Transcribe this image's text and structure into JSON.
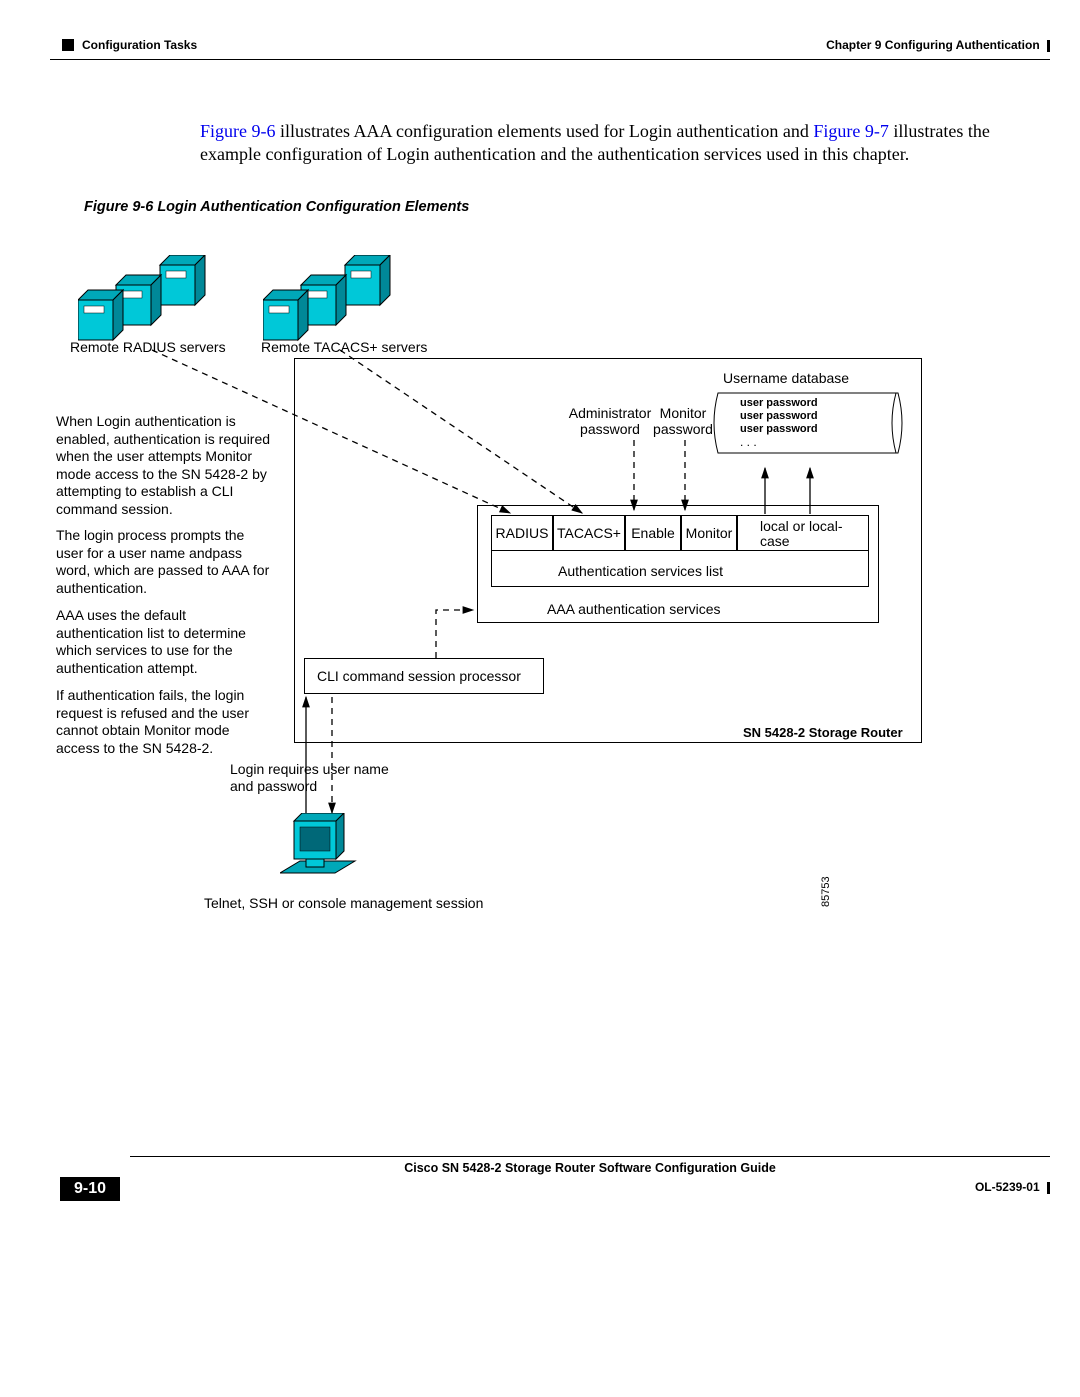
{
  "header": {
    "left": "Configuration Tasks",
    "right": "Chapter 9      Configuring Authentication"
  },
  "body": {
    "link1": "Figure 9-6",
    "text1": " illustrates AAA configuration elements used for Login authentication and ",
    "link2": "Figure 9-7",
    "text2": " illustrates the example configuration of Login authentication and the authentication services used in this chapter."
  },
  "figCaption": "Figure 9-6      Login Authentication Configuration Elements",
  "diagram": {
    "radiusServers": "Remote RADIUS servers",
    "tacacsServers": "Remote TACACS+ servers",
    "usernameDb": "Username database",
    "userPw1": "user    password",
    "userPw2": "user    password",
    "userPw3": "user    password",
    "dots": ". . .",
    "adminPw": "Administrator password",
    "monitorPw": "Monitor password",
    "radius": "RADIUS",
    "tacacs": "TACACS+",
    "enable": "Enable",
    "monitor": "Monitor",
    "localOr": "local or local-case",
    "authList": "Authentication services list",
    "aaaServices": "AAA authentication services",
    "cliProcessor": "CLI command session processor",
    "routerLabel": "SN 5428-2 Storage Router",
    "loginReq": "Login requires user name and password",
    "telnet": "Telnet, SSH or console management session",
    "idnum": "85753",
    "exp1": "When Login authentication is enabled, authentication is required when the user attempts Monitor mode access to the SN 5428-2 by attempting to establish a CLI command session.",
    "exp2": "The login process prompts the user for a user name andpass word, which are passed to AAA for authentication.",
    "exp3": "AAA uses the default authentication list to determine which services to use for the authentication attempt.",
    "exp4": "If authentication fails, the login request is refused and the user cannot obtain Monitor mode access to the SN 5428-2."
  },
  "footer": {
    "title": "Cisco SN 5428-2 Storage Router Software Configuration Guide",
    "pageNum": "9-10",
    "ol": "OL-5239-01"
  }
}
